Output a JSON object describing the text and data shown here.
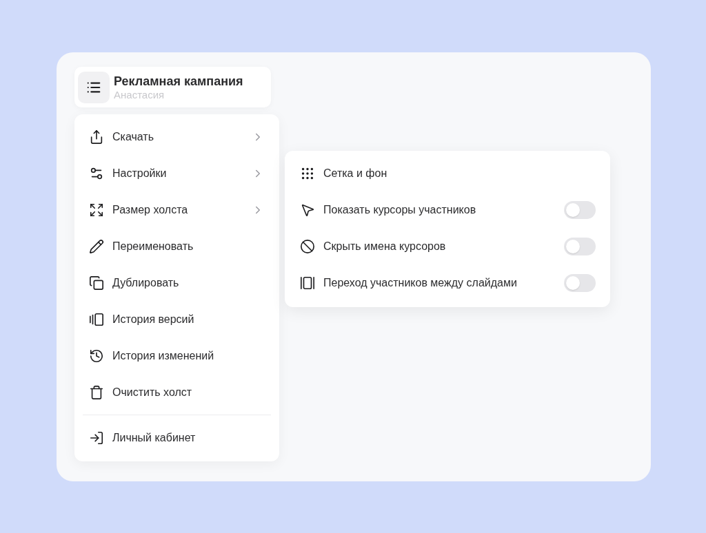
{
  "board": {
    "title": "Рекламная кампания",
    "owner": "Анастасия"
  },
  "menu": {
    "groups": [
      {
        "items": [
          {
            "label": "Скачать",
            "has_submenu": true
          },
          {
            "label": "Настройки",
            "has_submenu": true
          },
          {
            "label": "Размер холста",
            "has_submenu": true
          },
          {
            "label": "Переименовать",
            "has_submenu": false
          },
          {
            "label": "Дублировать",
            "has_submenu": false
          },
          {
            "label": "История версий",
            "has_submenu": false
          },
          {
            "label": "История изменений",
            "has_submenu": false
          },
          {
            "label": "Очистить холст",
            "has_submenu": false
          }
        ]
      },
      {
        "items": [
          {
            "label": "Личный кабинет",
            "has_submenu": false
          }
        ]
      }
    ]
  },
  "submenu": {
    "items": [
      {
        "kind": "link",
        "label": "Сетка и фон"
      },
      {
        "kind": "toggle",
        "label": "Показать курсоры участников",
        "on": false
      },
      {
        "kind": "toggle",
        "label": "Скрыть имена курсоров",
        "on": false
      },
      {
        "kind": "toggle",
        "label": "Переход участников между слайдами",
        "on": false
      }
    ]
  }
}
